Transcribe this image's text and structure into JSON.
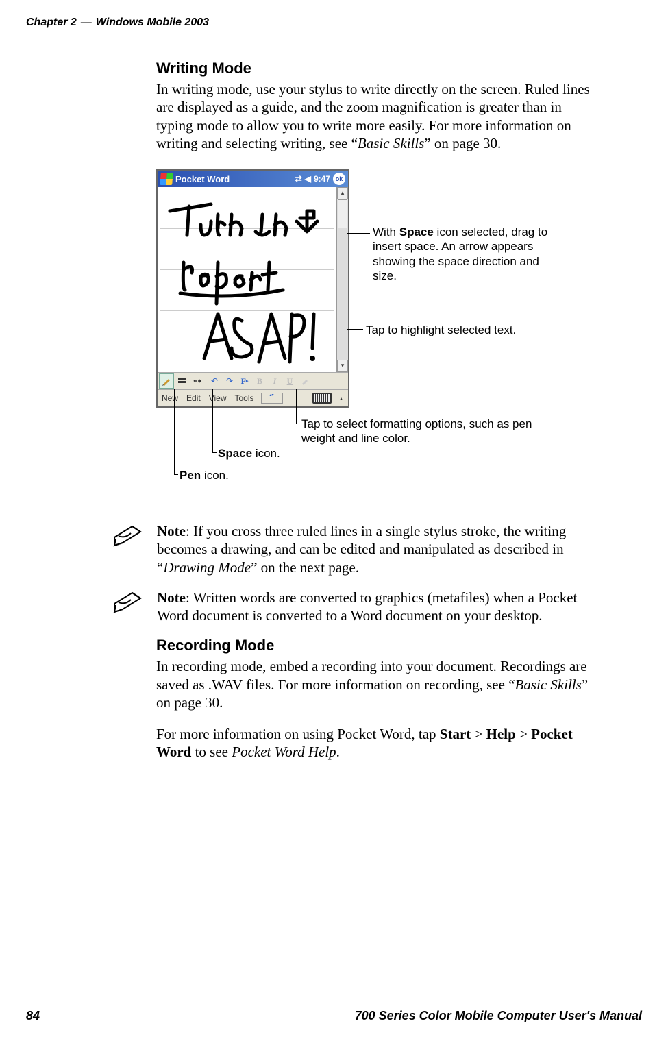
{
  "header": {
    "chapter": "Chapter 2",
    "sep": "—",
    "title": "Windows Mobile 2003"
  },
  "section1": {
    "heading": "Writing Mode",
    "body_parts": [
      "In writing mode, use your stylus to write directly on the screen. Ruled lines are displayed as a guide, and the zoom magnification is greater than in typing mode to allow you to write more easily. For more information on writing and selecting writing, see “",
      "Basic Skills",
      "” on page 30."
    ]
  },
  "screenshot": {
    "app_title": "Pocket Word",
    "time": "9:47",
    "ok": "ok",
    "menubar": {
      "new": "New",
      "edit": "Edit",
      "view": "View",
      "tools": "Tools"
    },
    "handwriting_text": "Turn in report ASAP!"
  },
  "callouts": {
    "space_arrow_pre": "With ",
    "space_arrow_bold": "Space",
    "space_arrow_post": " icon selected, drag to insert space. An arrow appears showing the space direction and size.",
    "highlight": "Tap to highlight selected text.",
    "format": "Tap to select formatting options, such as pen weight and line color.",
    "space_icon_bold": "Space",
    "space_icon_post": " icon.",
    "pen_icon_bold": "Pen",
    "pen_icon_post": " icon."
  },
  "note1": {
    "pre": "Note",
    "body_parts": [
      ": If you cross three ruled lines in a single stylus stroke, the writing becomes a drawing, and can be edited and manipulated as described in “",
      "Drawing Mode",
      "” on the next page."
    ]
  },
  "note2": {
    "pre": "Note",
    "body": ": Written words are converted to graphics (metafiles) when a Pocket Word document is converted to a Word document on your desktop."
  },
  "section2": {
    "heading": "Recording Mode",
    "body_parts": [
      "In recording mode, embed a recording into your document. Recordings are saved as .WAV files. For more information on recording, see “",
      "Basic Skills",
      "” on page 30."
    ],
    "body2_parts": [
      "For more information on using Pocket Word, tap ",
      "Start",
      " > ",
      "Help",
      " > ",
      "Pocket Word",
      " to see ",
      "Pocket Word Help",
      "."
    ]
  },
  "footer": {
    "page": "84",
    "manual": "700 Series Color Mobile Computer User's Manual"
  }
}
